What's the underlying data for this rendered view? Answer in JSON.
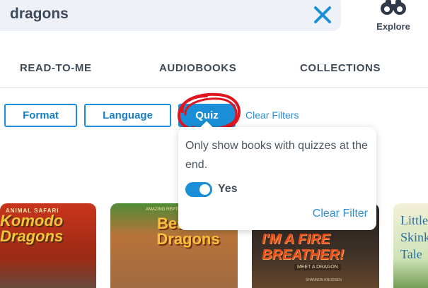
{
  "search": {
    "query": "dragons"
  },
  "explore": {
    "label": "Explore"
  },
  "tabs": [
    {
      "label": "READ-TO-ME"
    },
    {
      "label": "AUDIOBOOKS"
    },
    {
      "label": "COLLECTIONS"
    }
  ],
  "filters": {
    "format_label": "Format",
    "language_label": "Language",
    "quiz_label": "Quiz",
    "clear_filters_label": "Clear Filters"
  },
  "quiz_popover": {
    "description": "Only show books with quizzes at the end.",
    "toggle_label": "Yes",
    "toggle_on": true,
    "clear_filter_label": "Clear Filter"
  },
  "books": [
    {
      "series": "ANIMAL SAFARI",
      "title": "Komodo Dragons"
    },
    {
      "series": "AMAZING REPTILES",
      "title": "Bearded Dragons"
    },
    {
      "title": "I'M A FIRE BREATHER!",
      "subtitle": "MEET A DRAGON",
      "author": "SHANNON KNUDSEN"
    },
    {
      "title": "Little Skink's Tale"
    }
  ],
  "colors": {
    "accent": "#1a8fd8",
    "annotation": "#e0141e"
  }
}
